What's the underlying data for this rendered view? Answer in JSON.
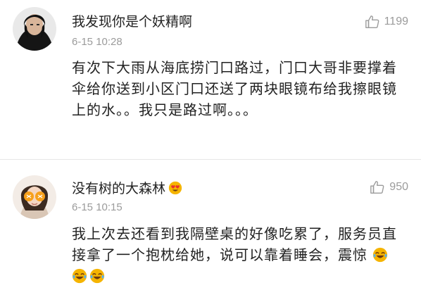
{
  "comments": [
    {
      "username": "我发现你是个妖精啊",
      "timestamp": "6-15 10:28",
      "likes": "1199",
      "body": "有次下大雨从海底捞门口路过，门口大哥非要撑着伞给你送到小区门口还送了两块眼镜布给我擦眼镜上的水。。我只是路过啊。。。",
      "avatar_icon": "user-avatar-photo"
    },
    {
      "username": "没有树的大森林",
      "timestamp": "6-15 10:15",
      "likes": "950",
      "body": "我上次去还看到我隔壁桌的好像吃累了，服务员直接拿了一个抱枕给她，说可以靠着睡会，震惊",
      "avatar_icon": "user-avatar-photo",
      "name_badge_icon": "heart-eyes-emoji-icon",
      "trailing_emoji_icon": "tears-of-joy-emoji-icon",
      "trailing_emoji_count": 3
    }
  ],
  "colors": {
    "text": "#222222",
    "meta": "#9b9b9b",
    "divider": "#e6e6e6",
    "emoji": "#f5b400"
  }
}
